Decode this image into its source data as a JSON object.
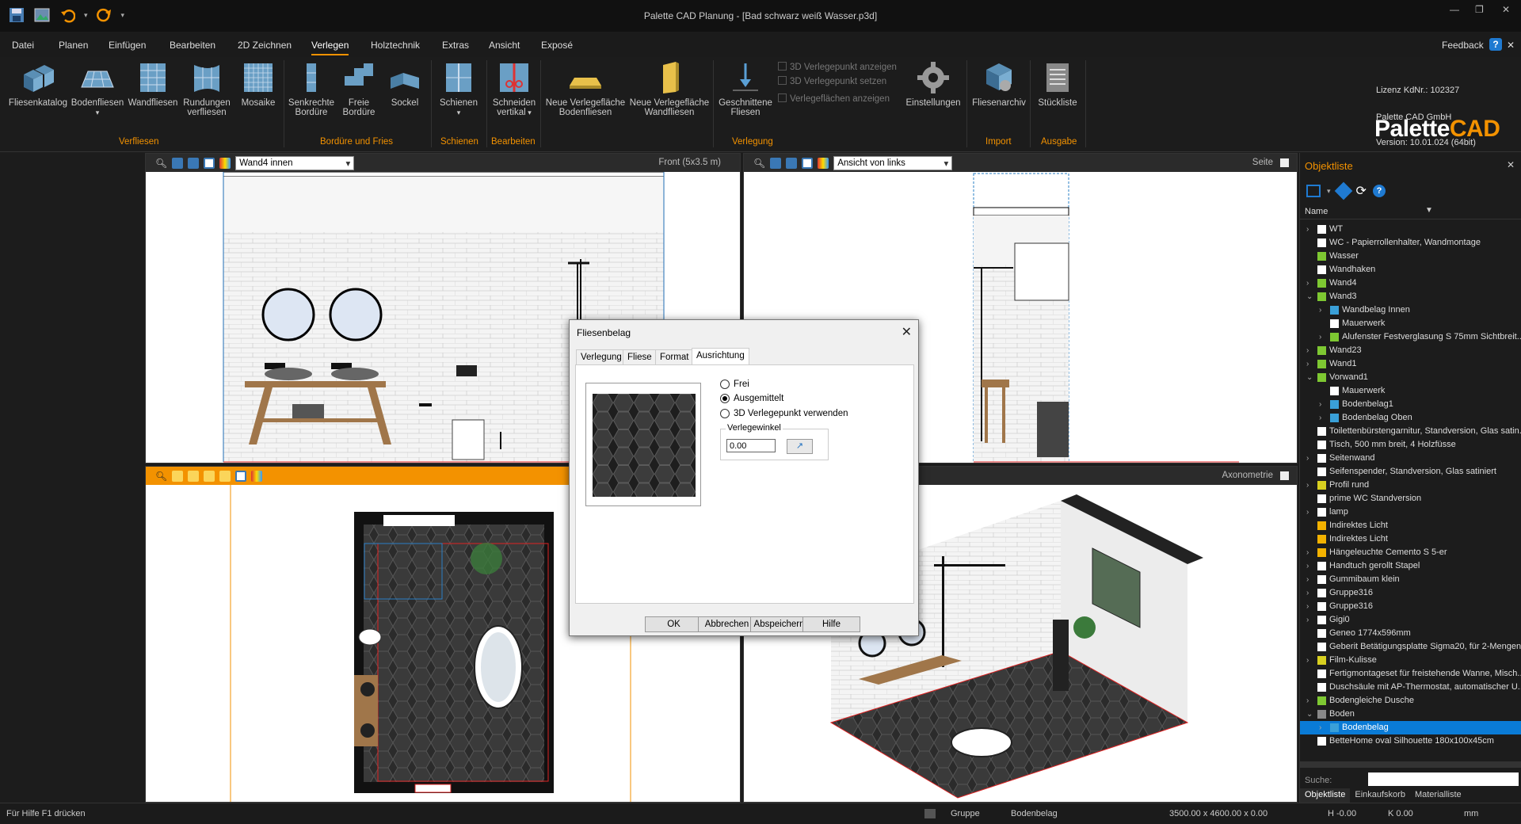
{
  "titlebar": {
    "title": "Palette CAD Planung - [Bad schwarz weiß Wasser.p3d]",
    "minimize": "—",
    "restore": "❐",
    "close": "✕"
  },
  "menu": {
    "items": [
      "Datei",
      "Planen",
      "Einfügen",
      "Bearbeiten",
      "2D Zeichnen",
      "Verlegen",
      "Holztechnik",
      "Extras",
      "Ansicht",
      "Exposé"
    ],
    "active": "Verlegen",
    "feedback": "Feedback",
    "help": "?",
    "close": "✕"
  },
  "ribbon": {
    "buttons": {
      "fliesenkatalog": "Fliesenkatalog",
      "bodenfliesen": "Bodenfliesen",
      "wandfliesen": "Wandfliesen",
      "rundungen": [
        "Rundungen",
        "verfliesen"
      ],
      "mosaike": "Mosaike",
      "senkrechte": [
        "Senkrechte",
        "Bordüre"
      ],
      "freie": [
        "Freie",
        "Bordüre"
      ],
      "sockel": "Sockel",
      "schienen": "Schienen",
      "schneiden": [
        "Schneiden",
        "vertikal"
      ],
      "neue_boden": [
        "Neue Verlegefläche",
        "Bodenfliesen"
      ],
      "neue_wand": [
        "Neue Verlegefläche",
        "Wandfliesen"
      ],
      "geschnittene": [
        "Geschnittene",
        "Fliesen"
      ],
      "einstellungen": "Einstellungen",
      "fliesenarchiv": "Fliesenarchiv",
      "stueckliste": "Stückliste"
    },
    "checkboxes": [
      "3D Verlegepunkt anzeigen",
      "3D Verlegepunkt setzen",
      "Verlegeflächen anzeigen"
    ],
    "groups": {
      "verfliesen": "Verfliesen",
      "bordure": "Bordüre und Fries",
      "schienen": "Schienen",
      "bearbeiten": "Bearbeiten",
      "verlegung": "Verlegung",
      "import": "Import",
      "ausgabe": "Ausgabe"
    }
  },
  "brand": {
    "name_a": "Palette",
    "name_b": "CAD",
    "license": "Lizenz KdNr.: 102327",
    "company": "Palette CAD GmbH",
    "version": "Version: 10.01.024 (64bit)"
  },
  "viewports": {
    "front": {
      "select": "Wand4 innen",
      "label": "Front  (5x3.5 m)"
    },
    "side": {
      "select": "Ansicht von links",
      "label": "Seite"
    },
    "axo": {
      "label": "Axonometrie"
    }
  },
  "objpanel": {
    "title": "Objektliste",
    "column": "Name",
    "items": [
      {
        "text": "WT",
        "level": 0,
        "tw": ">",
        "color": "#ffffff"
      },
      {
        "text": "WC - Papierrollenhalter, Wandmontage",
        "level": 0,
        "tw": "",
        "color": "#ffffff"
      },
      {
        "text": "Wasser",
        "level": 0,
        "tw": "",
        "color": "#7ec832"
      },
      {
        "text": "Wandhaken",
        "level": 0,
        "tw": "",
        "color": "#ffffff"
      },
      {
        "text": "Wand4",
        "level": 0,
        "tw": ">",
        "color": "#7ec832"
      },
      {
        "text": "Wand3",
        "level": 0,
        "tw": "v",
        "color": "#7ec832"
      },
      {
        "text": "Wandbelag Innen",
        "level": 1,
        "tw": ">",
        "color": "#3aa0d8"
      },
      {
        "text": "Mauerwerk",
        "level": 1,
        "tw": "",
        "color": "#ffffff"
      },
      {
        "text": "Alufenster Festverglasung S 75mm Sichtbreit...",
        "level": 1,
        "tw": ">",
        "color": "#7ec832"
      },
      {
        "text": "Wand23",
        "level": 0,
        "tw": ">",
        "color": "#7ec832"
      },
      {
        "text": "Wand1",
        "level": 0,
        "tw": ">",
        "color": "#7ec832"
      },
      {
        "text": "Vorwand1",
        "level": 0,
        "tw": "v",
        "color": "#7ec832"
      },
      {
        "text": "Mauerwerk",
        "level": 1,
        "tw": "",
        "color": "#ffffff"
      },
      {
        "text": "Bodenbelag1",
        "level": 1,
        "tw": ">",
        "color": "#3aa0d8"
      },
      {
        "text": "Bodenbelag Oben",
        "level": 1,
        "tw": ">",
        "color": "#3aa0d8"
      },
      {
        "text": "Toilettenbürstengarnitur, Standversion, Glas satin...",
        "level": 0,
        "tw": "",
        "color": "#ffffff"
      },
      {
        "text": "Tisch, 500 mm breit, 4 Holzfüsse",
        "level": 0,
        "tw": "",
        "color": "#ffffff"
      },
      {
        "text": "Seitenwand",
        "level": 0,
        "tw": ">",
        "color": "#ffffff"
      },
      {
        "text": "Seifenspender, Standversion, Glas satiniert",
        "level": 0,
        "tw": "",
        "color": "#ffffff"
      },
      {
        "text": "Profil rund",
        "level": 0,
        "tw": ">",
        "color": "#d8d020"
      },
      {
        "text": "prime WC Standversion",
        "level": 0,
        "tw": "",
        "color": "#ffffff"
      },
      {
        "text": "lamp",
        "level": 0,
        "tw": ">",
        "color": "#ffffff"
      },
      {
        "text": "Indirektes Licht",
        "level": 0,
        "tw": "",
        "color": "#f3b200"
      },
      {
        "text": "Indirektes Licht",
        "level": 0,
        "tw": "",
        "color": "#f3b200"
      },
      {
        "text": "Hängeleuchte Cemento S 5-er",
        "level": 0,
        "tw": ">",
        "color": "#f3b200"
      },
      {
        "text": "Handtuch gerollt Stapel",
        "level": 0,
        "tw": ">",
        "color": "#ffffff"
      },
      {
        "text": "Gummibaum klein",
        "level": 0,
        "tw": ">",
        "color": "#ffffff"
      },
      {
        "text": "Gruppe316",
        "level": 0,
        "tw": ">",
        "color": "#ffffff"
      },
      {
        "text": "Gruppe316",
        "level": 0,
        "tw": ">",
        "color": "#ffffff"
      },
      {
        "text": "Gigi0",
        "level": 0,
        "tw": ">",
        "color": "#ffffff"
      },
      {
        "text": "Geneo 1774x596mm",
        "level": 0,
        "tw": "",
        "color": "#ffffff"
      },
      {
        "text": "Geberit Betätigungsplatte Sigma20, für 2-Mengen...",
        "level": 0,
        "tw": "",
        "color": "#ffffff"
      },
      {
        "text": "Film-Kulisse",
        "level": 0,
        "tw": ">",
        "color": "#d8d020"
      },
      {
        "text": "Fertigmontageset für freistehende Wanne, Misch...",
        "level": 0,
        "tw": "",
        "color": "#ffffff"
      },
      {
        "text": "Duschsäule mit AP-Thermostat, automatischer U...",
        "level": 0,
        "tw": "",
        "color": "#ffffff"
      },
      {
        "text": "Bodengleiche Dusche",
        "level": 0,
        "tw": ">",
        "color": "#7ec832"
      },
      {
        "text": "Boden",
        "level": 0,
        "tw": "v",
        "color": "#888888"
      },
      {
        "text": "Bodenbelag",
        "level": 1,
        "tw": ">",
        "color": "#3aa0d8",
        "selected": true
      },
      {
        "text": "BetteHome oval Silhouette 180x100x45cm",
        "level": 0,
        "tw": "",
        "color": "#ffffff"
      }
    ],
    "search_label": "Suche:",
    "tabs": [
      "Objektliste",
      "Einkaufskorb",
      "Materialliste"
    ]
  },
  "dialog": {
    "title": "Fliesenbelag",
    "tabs": [
      "Verlegung",
      "Fliese",
      "Format",
      "Ausrichtung"
    ],
    "active_tab": "Ausrichtung",
    "radios": [
      {
        "label": "Frei",
        "checked": false
      },
      {
        "label": "Ausgemittelt",
        "checked": true
      },
      {
        "label": "3D Verlegepunkt verwenden",
        "checked": false
      }
    ],
    "angle_label": "Verlegewinkel",
    "angle_value": "0.00",
    "buttons": [
      "OK",
      "Abbrechen",
      "Abspeichern",
      "Hilfe"
    ]
  },
  "status": {
    "help": "Für Hilfe F1 drücken",
    "gruppe": "Gruppe",
    "object": "Bodenbelag",
    "dims": "3500.00 x 4600.00 x 0.00",
    "h": "H -0.00",
    "k": "K 0.00",
    "unit": "mm"
  }
}
